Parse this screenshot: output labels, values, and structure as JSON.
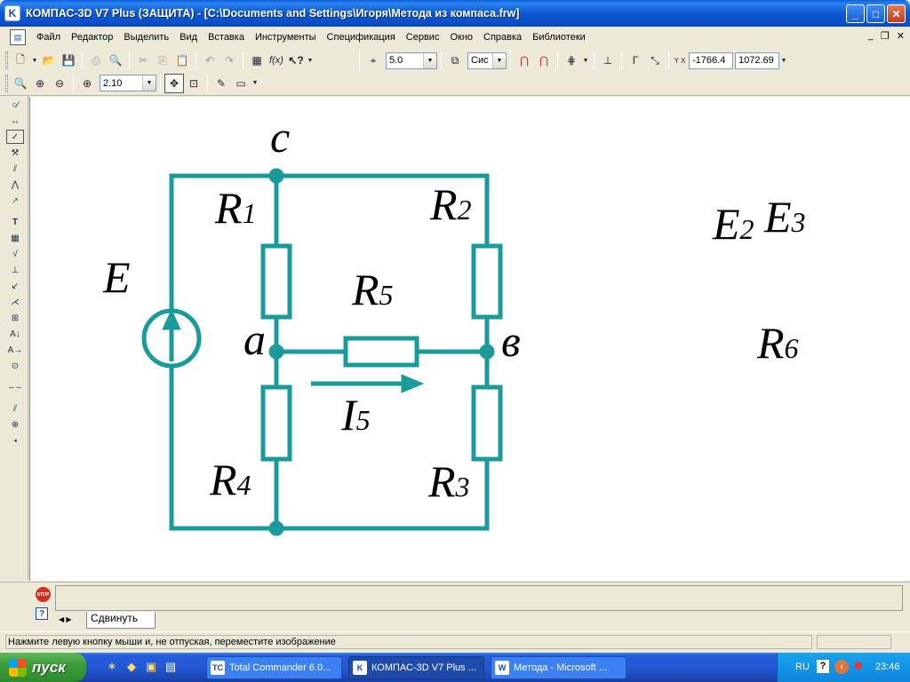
{
  "window": {
    "title": "КОМПАС-3D V7 Plus (ЗАЩИТА) - [C:\\Documents and Settings\\Игоря\\Метода из компаса.frw]",
    "app_icon": "kompas-logo-icon"
  },
  "menu": {
    "items": [
      "Файл",
      "Редактор",
      "Выделить",
      "Вид",
      "Вставка",
      "Инструменты",
      "Спецификация",
      "Сервис",
      "Окно",
      "Справка",
      "Библиотеки"
    ]
  },
  "toolbar1": {
    "step_value": "5.0",
    "layer_value": "Сис",
    "coord_x": "-1766.4",
    "coord_y": "1072.69",
    "coord_label": "Y X"
  },
  "toolbar2": {
    "zoom_value": "2.10"
  },
  "drawing": {
    "node_c": "c",
    "node_a": "a",
    "node_b": "в",
    "E": {
      "main": "E",
      "sub": ""
    },
    "R1": {
      "main": "R",
      "sub": "1"
    },
    "R2": {
      "main": "R",
      "sub": "2"
    },
    "R3": {
      "main": "R",
      "sub": "3"
    },
    "R4": {
      "main": "R",
      "sub": "4"
    },
    "R5": {
      "main": "R",
      "sub": "5"
    },
    "R6": {
      "main": "R",
      "sub": "6"
    },
    "I5": {
      "main": "I",
      "sub": "5"
    },
    "E2": {
      "main": "E",
      "sub": "2"
    },
    "E3": {
      "main": "E",
      "sub": "3"
    },
    "wire_color": "#1A9A9A"
  },
  "command_panel": {
    "tab_label": "Сдвинуть"
  },
  "status": {
    "hint": "Нажмите левую кнопку мыши и, не отпуская, переместите изображение"
  },
  "taskbar": {
    "start_label": "пуск",
    "tasks": [
      {
        "label": "Total Commander 6.0...",
        "icon": "TC"
      },
      {
        "label": "КОМПАС-3D V7 Plus ...",
        "icon": "K"
      },
      {
        "label": "Метода - Microsoft ...",
        "icon": "W"
      }
    ],
    "lang": "RU",
    "clock": "23:46"
  }
}
